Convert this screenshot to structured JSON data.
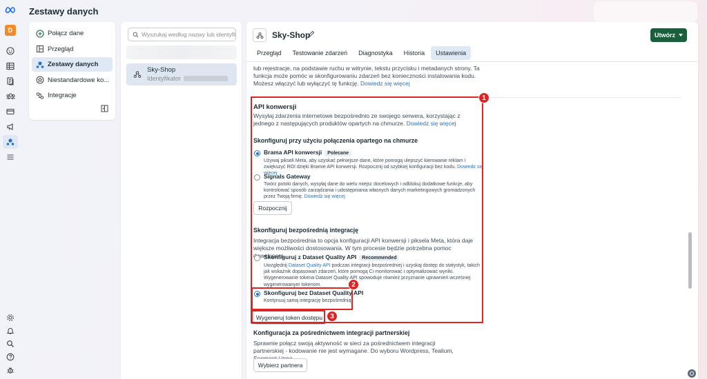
{
  "app": {
    "page_title": "Zestawy danych",
    "avatar_letter": "D"
  },
  "nav": {
    "items": [
      {
        "label": "Połącz dane",
        "icon": "plus-circle-icon"
      },
      {
        "label": "Przegląd",
        "icon": "layout-icon"
      },
      {
        "label": "Zestawy danych",
        "icon": "dataset-icon",
        "active": true
      },
      {
        "label": "Niestandardowe ko...",
        "icon": "star-icon"
      },
      {
        "label": "Integracje",
        "icon": "integrations-icon"
      }
    ]
  },
  "datasets": {
    "search_placeholder": "Wyszukaj według nazwy lub identyfikatora",
    "selected": {
      "name": "Sky-Shop",
      "id_label": "Identyfikator"
    }
  },
  "main": {
    "title": "Sky-Shop",
    "create_label": "Utwórz",
    "tabs": [
      {
        "label": "Przegląd"
      },
      {
        "label": "Testowanie zdarzeń"
      },
      {
        "label": "Diagnostyka"
      },
      {
        "label": "Historia"
      },
      {
        "label": "Ustawienia",
        "active": true
      }
    ],
    "intro_text": "lub rejestracje, na podstawie ruchu w witrynie, tekstu przycisku i metadanych strony. Ta funkcja może pomóc w skonfigurowaniu zdarzeń bez konieczności instalowania kodu. Możesz włączyć lub wyłączyć tę funkcję.",
    "intro_link": "Dowiedz się więcej",
    "capi": {
      "title": "API konwersji",
      "desc": "Wysyłaj zdarzenia internetowe bezpośrednio ze swojego serwera, korzystając z jednego z następujących produktów opartych na chmurze.",
      "link": "Dowiedz się więcej",
      "cloud_title": "Skonfiguruj przy użyciu połączenia opartego na chmurze",
      "gateway_title": "Brama API konwersji",
      "gateway_badge": "Polecane",
      "gateway_desc": "Używaj pikseli Meta, aby uzyskać pełniejsze dane, które pomogą ulepszyć kierowanie reklam i zwiększyć ROI dzięki Bramie API konwersji. Rozpocznij od szybkiej konfiguracji bez kodu.",
      "gateway_link": "Dowiedz się więcej",
      "signals_title": "Signals Gateway",
      "signals_desc": "Twórz potoki danych, wysyłaj dane do wielu miejsc docelowych i odblokuj dodatkowe funkcje, aby kontrolować sposób zarządzania i udostępniania własnych danych marketingowych gromadzonych przez Twoją firmę.",
      "signals_link": "Dowiedz się więcej",
      "start_button": "Rozpocznij",
      "direct_title": "Skonfiguruj bezpośrednią integrację",
      "direct_desc": "Integracja bezpośrednia to opcja konfiguracji API konwersji i piksela Meta, która daje większe możliwości dostosowania. W tym procesie będzie potrzebna pomoc dewelopera.",
      "dq_title": "Skonfiguruj z Dataset Quality API",
      "dq_badge": "Recommended",
      "dq_desc_pre": "Uwzględnij",
      "dq_desc_link": "Dataset Quality API",
      "dq_desc_post": "podczas integracji bezpośredniej i uzyskaj dostęp do statystyk, takich jak wskaźnik dopasowań zdarzeń, które pomogą Ci monitorować i optymalizować wyniki. Wygenerowanie tokena Dataset Quality API spowoduje również przyznanie uprawnień wcześniej wygenerowanym tokenom.",
      "nodq_title": "Skonfiguruj bez Dataset Quality API",
      "nodq_desc": "Kontynuuj samą integrację bezpośrednią.",
      "token_button": "Wygeneruj token dostępu"
    },
    "partner": {
      "title": "Konfiguracja za pośrednictwem integracji partnerskiej",
      "desc": "Sprawnie połącz swoją aktywność w sieci za pośrednictwem integracji partnerskiej - kodowanie nie jest wymagane. Do wyboru Wordpress, Tealium, Segment i inne.",
      "button": "Wybierz partnera"
    }
  },
  "annotations": {
    "n1": "1",
    "n2": "2",
    "n3": "3",
    "color": "#e02424"
  },
  "colors": {
    "accent": "#2672c4",
    "create_button": "#1b5e3c",
    "avatar": "#f28c28"
  }
}
